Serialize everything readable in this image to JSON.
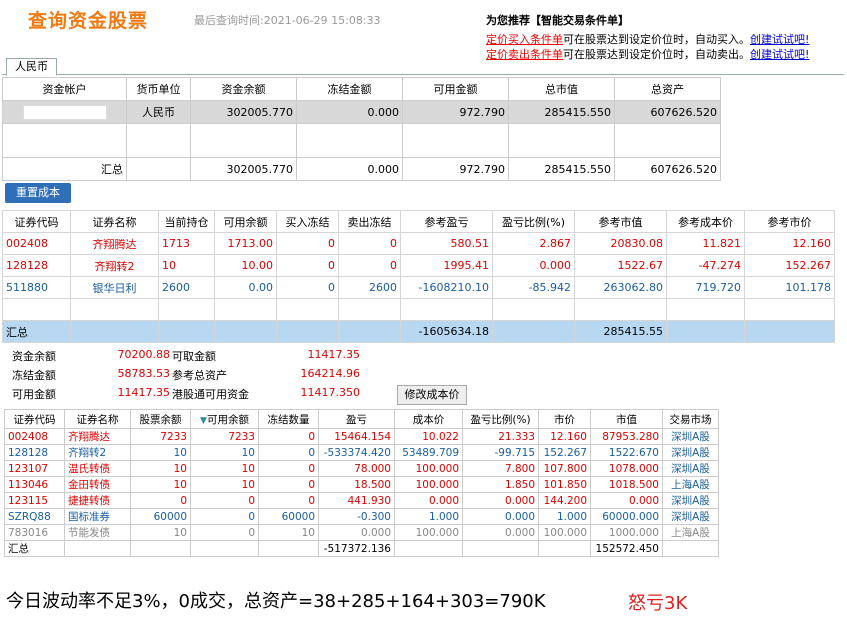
{
  "header": {
    "title": "查询资金股票",
    "last_query": "最后查询时间:2021-06-29 15:08:33",
    "recommend_title": "为您推荐【智能交易条件单】",
    "lines": [
      {
        "link": "定价买入条件单",
        "text": "可在股票达到设定价位时，自动买入。",
        "cta": "创建试试吧!"
      },
      {
        "link": "定价卖出条件单",
        "text": "可在股票达到设定价位时，自动卖出。",
        "cta": "创建试试吧!"
      }
    ]
  },
  "tab": "人民币",
  "funds": {
    "headers": [
      "资金帐户",
      "货币单位",
      "资金余额",
      "冻结金额",
      "可用金额",
      "总市值",
      "总资产"
    ],
    "row": {
      "currency": "人民币",
      "balance": "302005.770",
      "frozen": "0.000",
      "available": "972.790",
      "market_value": "285415.550",
      "total_assets": "607626.520"
    },
    "summary": {
      "label": "汇总",
      "balance": "302005.770",
      "frozen": "0.000",
      "available": "972.790",
      "market_value": "285415.550",
      "total_assets": "607626.520"
    }
  },
  "reset_cost": "重置成本",
  "positions": {
    "headers": [
      "证券代码",
      "证券名称",
      "当前持仓",
      "可用余额",
      "买入冻结",
      "卖出冻结",
      "参考盈亏",
      "盈亏比例(%)",
      "参考市值",
      "参考成本价",
      "参考市价"
    ],
    "rows": [
      {
        "code": "002408",
        "name": "齐翔腾达",
        "hold": "1713",
        "avail": "1713.00",
        "buy_frz": "0",
        "sell_frz": "0",
        "pnl": "580.51",
        "pct": "2.867",
        "mv": "20830.08",
        "cost": "11.821",
        "price": "12.160",
        "color": "red"
      },
      {
        "code": "128128",
        "name": "齐翔转2",
        "hold": "10",
        "avail": "10.00",
        "buy_frz": "0",
        "sell_frz": "0",
        "pnl": "1995.41",
        "pct": "0.000",
        "mv": "1522.67",
        "cost": "-47.274",
        "price": "152.267",
        "color": "red"
      },
      {
        "code": "511880",
        "name": "银华日利",
        "hold": "2600",
        "avail": "0.00",
        "buy_frz": "0",
        "sell_frz": "2600",
        "pnl": "-1608210.10",
        "pct": "-85.942",
        "mv": "263062.80",
        "cost": "719.720",
        "price": "101.178",
        "color": "blu"
      }
    ],
    "summary": {
      "label": "汇总",
      "pnl": "-1605634.18",
      "mv": "285415.55"
    }
  },
  "info": {
    "balance_lbl": "资金余额",
    "balance": "70200.88",
    "withdraw_lbl": "可取金额",
    "withdraw": "11417.35",
    "frozen_lbl": "冻结金额",
    "frozen": "58783.53",
    "ref_assets_lbl": "参考总资产",
    "ref_assets": "164214.96",
    "avail_lbl": "可用金额",
    "avail": "11417.35",
    "hk_lbl": "港股通可用资金",
    "hk": "11417.350",
    "modify_cost": "修改成本价"
  },
  "holdings": {
    "headers": [
      "证券代码",
      "证券名称",
      "股票余额",
      "可用余额",
      "冻结数量",
      "盈亏",
      "成本价",
      "盈亏比例(%)",
      "市价",
      "市值",
      "交易市场"
    ],
    "sort_icon": "▼",
    "rows": [
      {
        "code": "002408",
        "name": "齐翔腾达",
        "bal": "7233",
        "avail": "7233",
        "frz": "0",
        "pnl": "15464.154",
        "cost": "10.022",
        "pct": "21.333",
        "price": "12.160",
        "mv": "87953.280",
        "mkt": "深圳A股",
        "color": "red"
      },
      {
        "code": "128128",
        "name": "齐翔转2",
        "bal": "10",
        "avail": "10",
        "frz": "0",
        "pnl": "-533374.420",
        "cost": "53489.709",
        "pct": "-99.715",
        "price": "152.267",
        "mv": "1522.670",
        "mkt": "深圳A股",
        "color": "blu"
      },
      {
        "code": "123107",
        "name": "温氏转债",
        "bal": "10",
        "avail": "10",
        "frz": "0",
        "pnl": "78.000",
        "cost": "100.000",
        "pct": "7.800",
        "price": "107.800",
        "mv": "1078.000",
        "mkt": "深圳A股",
        "color": "red"
      },
      {
        "code": "113046",
        "name": "金田转债",
        "bal": "10",
        "avail": "10",
        "frz": "0",
        "pnl": "18.500",
        "cost": "100.000",
        "pct": "1.850",
        "price": "101.850",
        "mv": "1018.500",
        "mkt": "上海A股",
        "color": "red"
      },
      {
        "code": "123115",
        "name": "捷捷转债",
        "bal": "0",
        "avail": "0",
        "frz": "0",
        "pnl": "441.930",
        "cost": "0.000",
        "pct": "0.000",
        "price": "144.200",
        "mv": "0.000",
        "mkt": "深圳A股",
        "color": "red"
      },
      {
        "code": "SZRQ88",
        "name": "国标准券",
        "bal": "60000",
        "avail": "0",
        "frz": "60000",
        "pnl": "-0.300",
        "cost": "1.000",
        "pct": "0.000",
        "price": "1.000",
        "mv": "60000.000",
        "mkt": "深圳A股",
        "color": "blu"
      },
      {
        "code": "783016",
        "name": "节能发债",
        "bal": "10",
        "avail": "0",
        "frz": "10",
        "pnl": "0.000",
        "cost": "100.000",
        "pct": "0.000",
        "price": "100.000",
        "mv": "1000.000",
        "mkt": "上海A股",
        "color": "gray"
      }
    ],
    "summary": {
      "label": "汇总",
      "pnl": "-517372.136",
      "mv": "152572.450"
    }
  },
  "footer": {
    "note": "今日波动率不足3%，0成交，总资产=38+285+164+303=790K",
    "comment": "怒亏3K"
  }
}
